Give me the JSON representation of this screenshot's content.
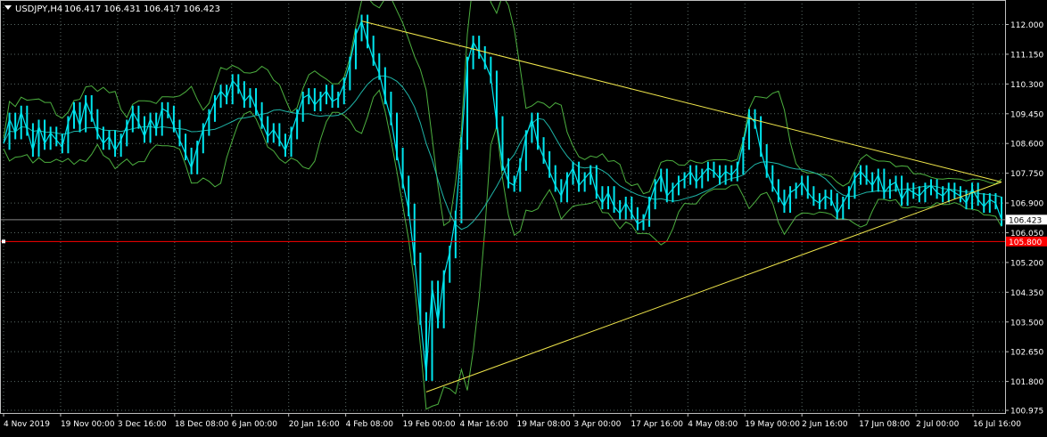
{
  "header": {
    "symbol_label": "USDJPY,H4",
    "ohlc_label": "106.417 106.431 106.417 106.423"
  },
  "colors": {
    "background": "#000000",
    "frame": "#c0c0c0",
    "grid": "#5a6a66",
    "price": "#00e5ee",
    "moving_average": "#1fb5a8",
    "bollinger_bands": "#4caf3f",
    "trendlines": "#f0e64b",
    "current_price_line": "#888888",
    "alert_line": "#ff0000",
    "text": "#ffffff"
  },
  "chart_data": {
    "type": "line",
    "title": "USDJPY,H4",
    "ylim": [
      100.9,
      112.7
    ],
    "y_ticks": [
      "112.000",
      "111.150",
      "110.300",
      "109.450",
      "108.600",
      "107.750",
      "106.900",
      "106.050",
      "105.200",
      "104.350",
      "103.500",
      "102.650",
      "101.800",
      "100.975"
    ],
    "x_ticks": [
      "4 Nov 2019",
      "19 Nov 00:00",
      "3 Dec 16:00",
      "18 Dec 08:00",
      "6 Jan 00:00",
      "20 Jan 16:00",
      "4 Feb 08:00",
      "19 Feb 00:00",
      "4 Mar 16:00",
      "19 Mar 08:00",
      "3 Apr 00:00",
      "17 Apr 16:00",
      "4 May 08:00",
      "19 May 00:00",
      "2 Jun 16:00",
      "17 Jun 08:00",
      "2 Jul 00:00",
      "16 Jul 16:00"
    ],
    "current_price": "106.423",
    "current_price_value": 106.423,
    "alert_price": "105.800",
    "alert_price_value": 105.8,
    "x_count": 171,
    "series": [
      {
        "values": [
          108.6,
          109.3,
          108.9,
          109.5,
          109.0,
          108.4,
          109.1,
          108.6,
          108.9,
          108.7,
          108.5,
          109.2,
          109.6,
          109.1,
          109.8,
          109.4,
          108.9,
          108.6,
          108.8,
          108.4,
          108.7,
          109.1,
          109.5,
          109.2,
          108.8,
          109.3,
          109.0,
          109.6,
          109.5,
          109.1,
          108.7,
          108.3,
          107.9,
          108.5,
          109.0,
          109.4,
          109.8,
          110.1,
          109.9,
          110.4,
          110.2,
          109.8,
          110.0,
          109.6,
          109.2,
          108.8,
          109.0,
          108.7,
          108.4,
          108.9,
          109.4,
          109.9,
          110.0,
          109.7,
          109.9,
          110.1,
          109.8,
          109.9,
          110.3,
          110.9,
          111.7,
          112.1,
          111.5,
          111.0,
          110.6,
          109.9,
          109.3,
          108.3,
          107.5,
          106.7,
          105.3,
          103.6,
          102.0,
          104.5,
          103.5,
          104.8,
          105.5,
          106.5,
          108.6,
          110.9,
          111.5,
          111.2,
          110.9,
          110.5,
          109.2,
          108.0,
          107.5,
          107.4,
          108.0,
          108.8,
          109.3,
          108.6,
          108.2,
          107.8,
          107.4,
          107.1,
          107.6,
          107.9,
          107.4,
          107.6,
          107.8,
          107.2,
          106.9,
          107.2,
          106.8,
          106.6,
          106.9,
          106.6,
          106.3,
          106.4,
          106.9,
          107.4,
          107.7,
          107.1,
          107.3,
          107.5,
          107.6,
          107.8,
          107.5,
          107.7,
          107.9,
          107.8,
          107.6,
          107.8,
          107.7,
          107.9,
          108.6,
          109.4,
          109.2,
          108.4,
          107.8,
          107.4,
          107.1,
          106.8,
          107.2,
          107.3,
          107.5,
          107.2,
          107.0,
          106.9,
          107.1,
          107.0,
          106.6,
          106.9,
          107.2,
          107.6,
          107.8,
          107.6,
          107.4,
          107.7,
          107.2,
          107.4,
          107.5,
          107.0,
          107.3,
          107.2,
          107.1,
          107.3,
          107.4,
          107.2,
          107.1,
          107.3,
          107.2,
          107.1,
          106.9,
          107.3,
          107.0,
          106.8,
          107.0,
          106.9,
          106.423
        ]
      }
    ],
    "trendline_upper": {
      "from": [
        61,
        112.1
      ],
      "to": [
        170,
        107.5
      ]
    },
    "trendline_lower": {
      "from": [
        72,
        101.5
      ],
      "to": [
        170,
        107.5
      ]
    }
  }
}
